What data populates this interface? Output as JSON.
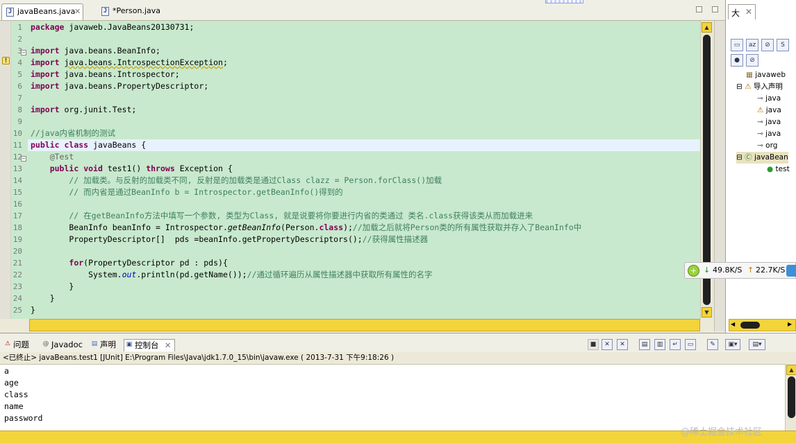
{
  "editor_tabs": [
    {
      "label": "javaBeans.java",
      "icon": "J"
    },
    {
      "label": "*Person.java",
      "icon": "J"
    }
  ],
  "code_lines": [
    {
      "n": "1",
      "text": "package javaweb.JavaBeans20130731;",
      "cls": "plain"
    },
    {
      "n": "2",
      "text": "",
      "cls": "plain"
    },
    {
      "n": "3",
      "text": "import java.beans.BeanInfo;",
      "cls": "import"
    },
    {
      "n": "4",
      "text": "import java.beans.IntrospectionException;",
      "cls": "importwarn"
    },
    {
      "n": "5",
      "text": "import java.beans.Introspector;",
      "cls": "import"
    },
    {
      "n": "6",
      "text": "import java.beans.PropertyDescriptor;",
      "cls": "import"
    },
    {
      "n": "7",
      "text": "",
      "cls": "plain"
    },
    {
      "n": "8",
      "text": "import org.junit.Test;",
      "cls": "import"
    },
    {
      "n": "9",
      "text": "",
      "cls": "plain"
    },
    {
      "n": "10",
      "text": "//java内省机制的测试",
      "cls": "comment"
    },
    {
      "n": "11",
      "text": "public class javaBeans {",
      "cls": "classdecl"
    },
    {
      "n": "12",
      "text": "    @Test",
      "cls": "annot"
    },
    {
      "n": "13",
      "text": "    public void test1() throws Exception {",
      "cls": "method"
    },
    {
      "n": "14",
      "text": "        // 加载类。与反射的加载类不同, 反射是的加载类是通过Class clazz = Person.forClass()加载",
      "cls": "comment"
    },
    {
      "n": "15",
      "text": "        // 而内省是通过BeanInfo b = Introspector.getBeanInfo()得到的",
      "cls": "comment"
    },
    {
      "n": "16",
      "text": "",
      "cls": "plain"
    },
    {
      "n": "17",
      "text": "        // 在getBeanInfo方法中填写一个参数, 类型为Class, 就是说要将你要进行内省的类通过 类名.class获得该类从而加载进来",
      "cls": "comment"
    },
    {
      "n": "18",
      "text": "        BeanInfo beanInfo = Introspector.getBeanInfo(Person.class);//加载之后就将Person类的所有属性获取并存入了BeanInfo中",
      "cls": "line18"
    },
    {
      "n": "19",
      "text": "        PropertyDescriptor[]  pds =beanInfo.getPropertyDescriptors();//获得属性描述器",
      "cls": "line19"
    },
    {
      "n": "20",
      "text": "",
      "cls": "plain"
    },
    {
      "n": "21",
      "text": "        for(PropertyDescriptor pd : pds){",
      "cls": "forloop"
    },
    {
      "n": "22",
      "text": "            System.out.println(pd.getName());//通过循环遍历从属性描述器中获取所有属性的名字",
      "cls": "println"
    },
    {
      "n": "23",
      "text": "        }",
      "cls": "plain"
    },
    {
      "n": "24",
      "text": "    }",
      "cls": "plain"
    },
    {
      "n": "25",
      "text": "}",
      "cls": "plain"
    }
  ],
  "outline": {
    "tab_label": "大",
    "nodes": [
      "javaweb",
      "导入声明",
      "java",
      "java",
      "java",
      "java",
      "org",
      "javaBean",
      "test"
    ]
  },
  "netspeed": {
    "down": "49.8K/S",
    "up": "22.7K/S"
  },
  "console": {
    "tabs": [
      "问题",
      "Javadoc",
      "声明",
      "控制台"
    ],
    "status": "<已终止> javaBeans.test1 [JUnit] E:\\Program Files\\Java\\jdk1.7.0_15\\bin\\javaw.exe ( 2013-7-31 下午9:18:26 )",
    "output": [
      "a",
      "age",
      "class",
      "name",
      "password"
    ]
  },
  "watermark": "@稀土掘金技术社区",
  "colors": {
    "editor_bg": "#c8e9cd",
    "current_line": "#e8f2fe",
    "keyword": "#7f0055",
    "comment": "#3f7f5f",
    "scrollbar": "#f3d43a"
  }
}
